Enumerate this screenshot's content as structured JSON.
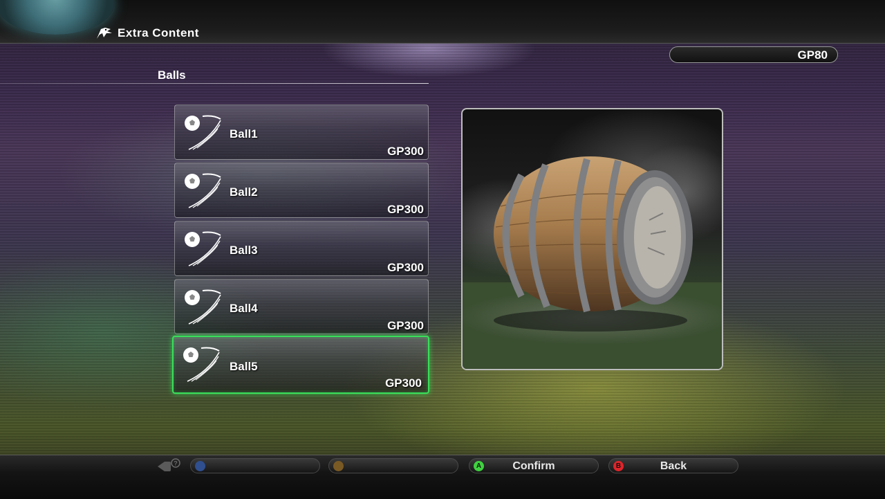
{
  "header": {
    "breadcrumb_icon": "dragon-logo-icon",
    "breadcrumb_label": "Extra Content"
  },
  "wallet": {
    "gp_balance": "GP80"
  },
  "section": {
    "title": "Balls"
  },
  "items": [
    {
      "name": "Ball1",
      "price": "GP300",
      "icon": "ball-icon",
      "selected": false
    },
    {
      "name": "Ball2",
      "price": "GP300",
      "icon": "ball-icon",
      "selected": false
    },
    {
      "name": "Ball3",
      "price": "GP300",
      "icon": "ball-icon",
      "selected": false
    },
    {
      "name": "Ball4",
      "price": "GP300",
      "icon": "ball-icon",
      "selected": false
    },
    {
      "name": "Ball5",
      "price": "GP300",
      "icon": "ball-icon",
      "selected": true
    }
  ],
  "preview": {
    "image": "barrel-ball-preview"
  },
  "footer": {
    "buttons": [
      {
        "label": "",
        "color": "#2f6fd6",
        "icon": "x-button-icon"
      },
      {
        "label": "",
        "color": "#d49a2a",
        "icon": "y-button-icon"
      },
      {
        "label": "Confirm",
        "color": "#3fd23f",
        "icon": "a-button-icon"
      },
      {
        "label": "Back",
        "color": "#e0242a",
        "icon": "b-button-icon"
      }
    ]
  },
  "colors": {
    "selection": "#39e05a"
  }
}
